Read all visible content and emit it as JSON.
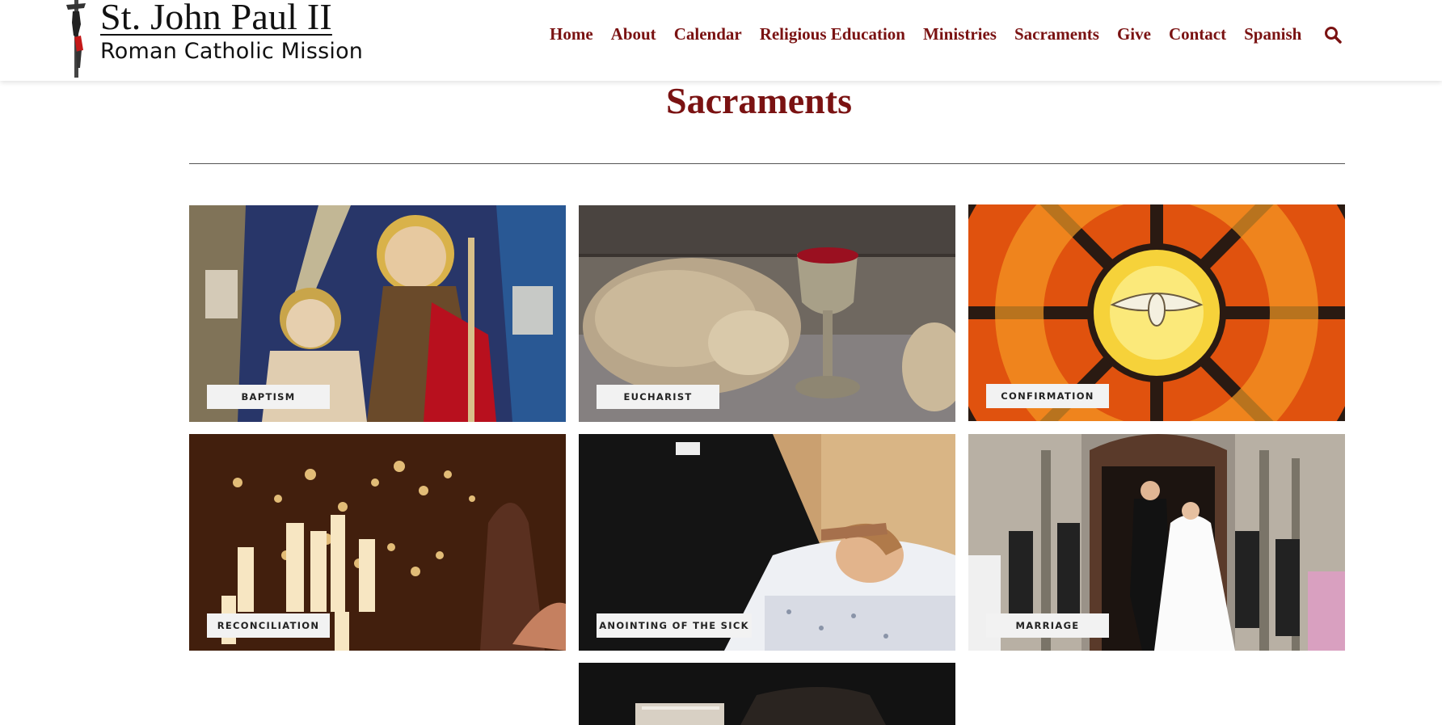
{
  "site": {
    "title": "St. John Paul II",
    "subtitle": "Roman Catholic Mission"
  },
  "nav": {
    "items": [
      "Home",
      "About",
      "Calendar",
      "Religious Education",
      "Ministries",
      "Sacraments",
      "Give",
      "Contact",
      "Spanish"
    ],
    "search_icon": "search-icon"
  },
  "page": {
    "title": "Sacraments"
  },
  "sacraments": [
    {
      "label": "BAPTISM"
    },
    {
      "label": "EUCHARIST"
    },
    {
      "label": "CONFIRMATION"
    },
    {
      "label": "RECONCILIATION"
    },
    {
      "label": "ANOINTING OF THE SICK"
    },
    {
      "label": "MARRIAGE"
    }
  ],
  "colors": {
    "accent": "#7a1212",
    "label_bg": "#f2f2f2",
    "label_text": "#222222"
  }
}
